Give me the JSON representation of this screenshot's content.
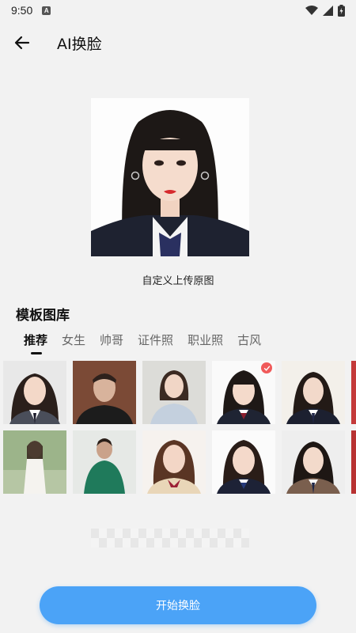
{
  "status_bar": {
    "time": "9:50",
    "notif_letter": "A"
  },
  "header": {
    "title": "AI换脸"
  },
  "preview": {
    "caption": "自定义上传原图"
  },
  "gallery": {
    "title": "模板图库",
    "tabs": [
      "推荐",
      "女生",
      "帅哥",
      "证件照",
      "职业照",
      "古风"
    ],
    "active_tab": "推荐"
  },
  "actions": {
    "start_label": "开始换脸"
  },
  "colors": {
    "accent": "#4ba3f7",
    "badge": "#f05a5a",
    "background": "#f2f2f2"
  }
}
